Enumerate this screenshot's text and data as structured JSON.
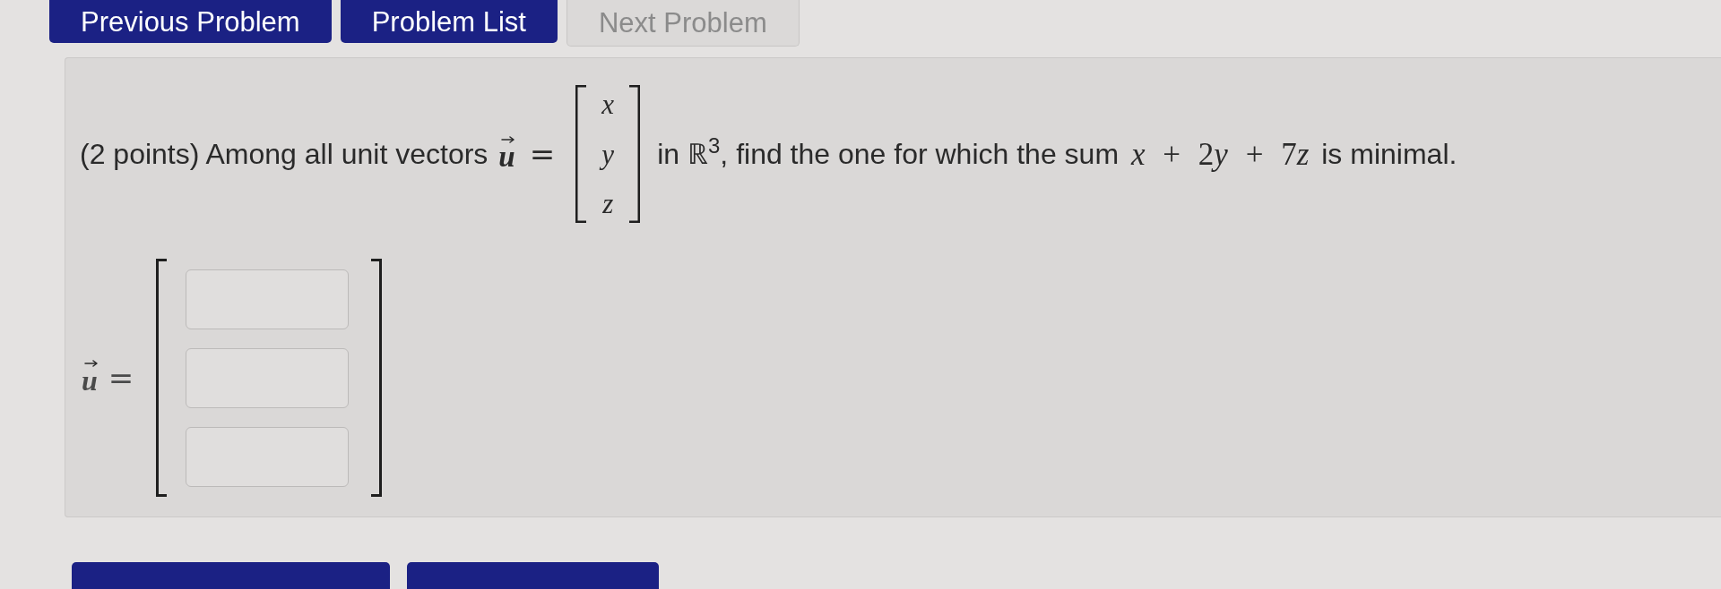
{
  "nav_buttons": [
    {
      "label": "Previous Problem",
      "disabled": false
    },
    {
      "label": "Problem List",
      "disabled": false
    },
    {
      "label": "Next Problem",
      "disabled": true
    }
  ],
  "problem": {
    "segments": [
      {
        "kind": "text",
        "text": "(2 points) Among all unit vectors"
      },
      {
        "kind": "vector",
        "text": "u"
      },
      {
        "kind": "relation",
        "text": "="
      },
      {
        "kind": "matrix",
        "entries": [
          "x",
          "y",
          "z"
        ]
      },
      {
        "kind": "text",
        "text": "in ℝ$^{3}$, find the one for which the sum"
      },
      {
        "kind": "math",
        "text": "x + 2y + 7z"
      },
      {
        "kind": "text",
        "text": "is minimal."
      }
    ]
  },
  "answer": {
    "vector": "u",
    "relation": "=",
    "entries": [
      {
        "kind": "input"
      },
      {
        "kind": "input"
      },
      {
        "kind": "input"
      }
    ]
  },
  "action_buttons": [
    {
      "disabled": false
    },
    {
      "disabled": false
    }
  ]
}
